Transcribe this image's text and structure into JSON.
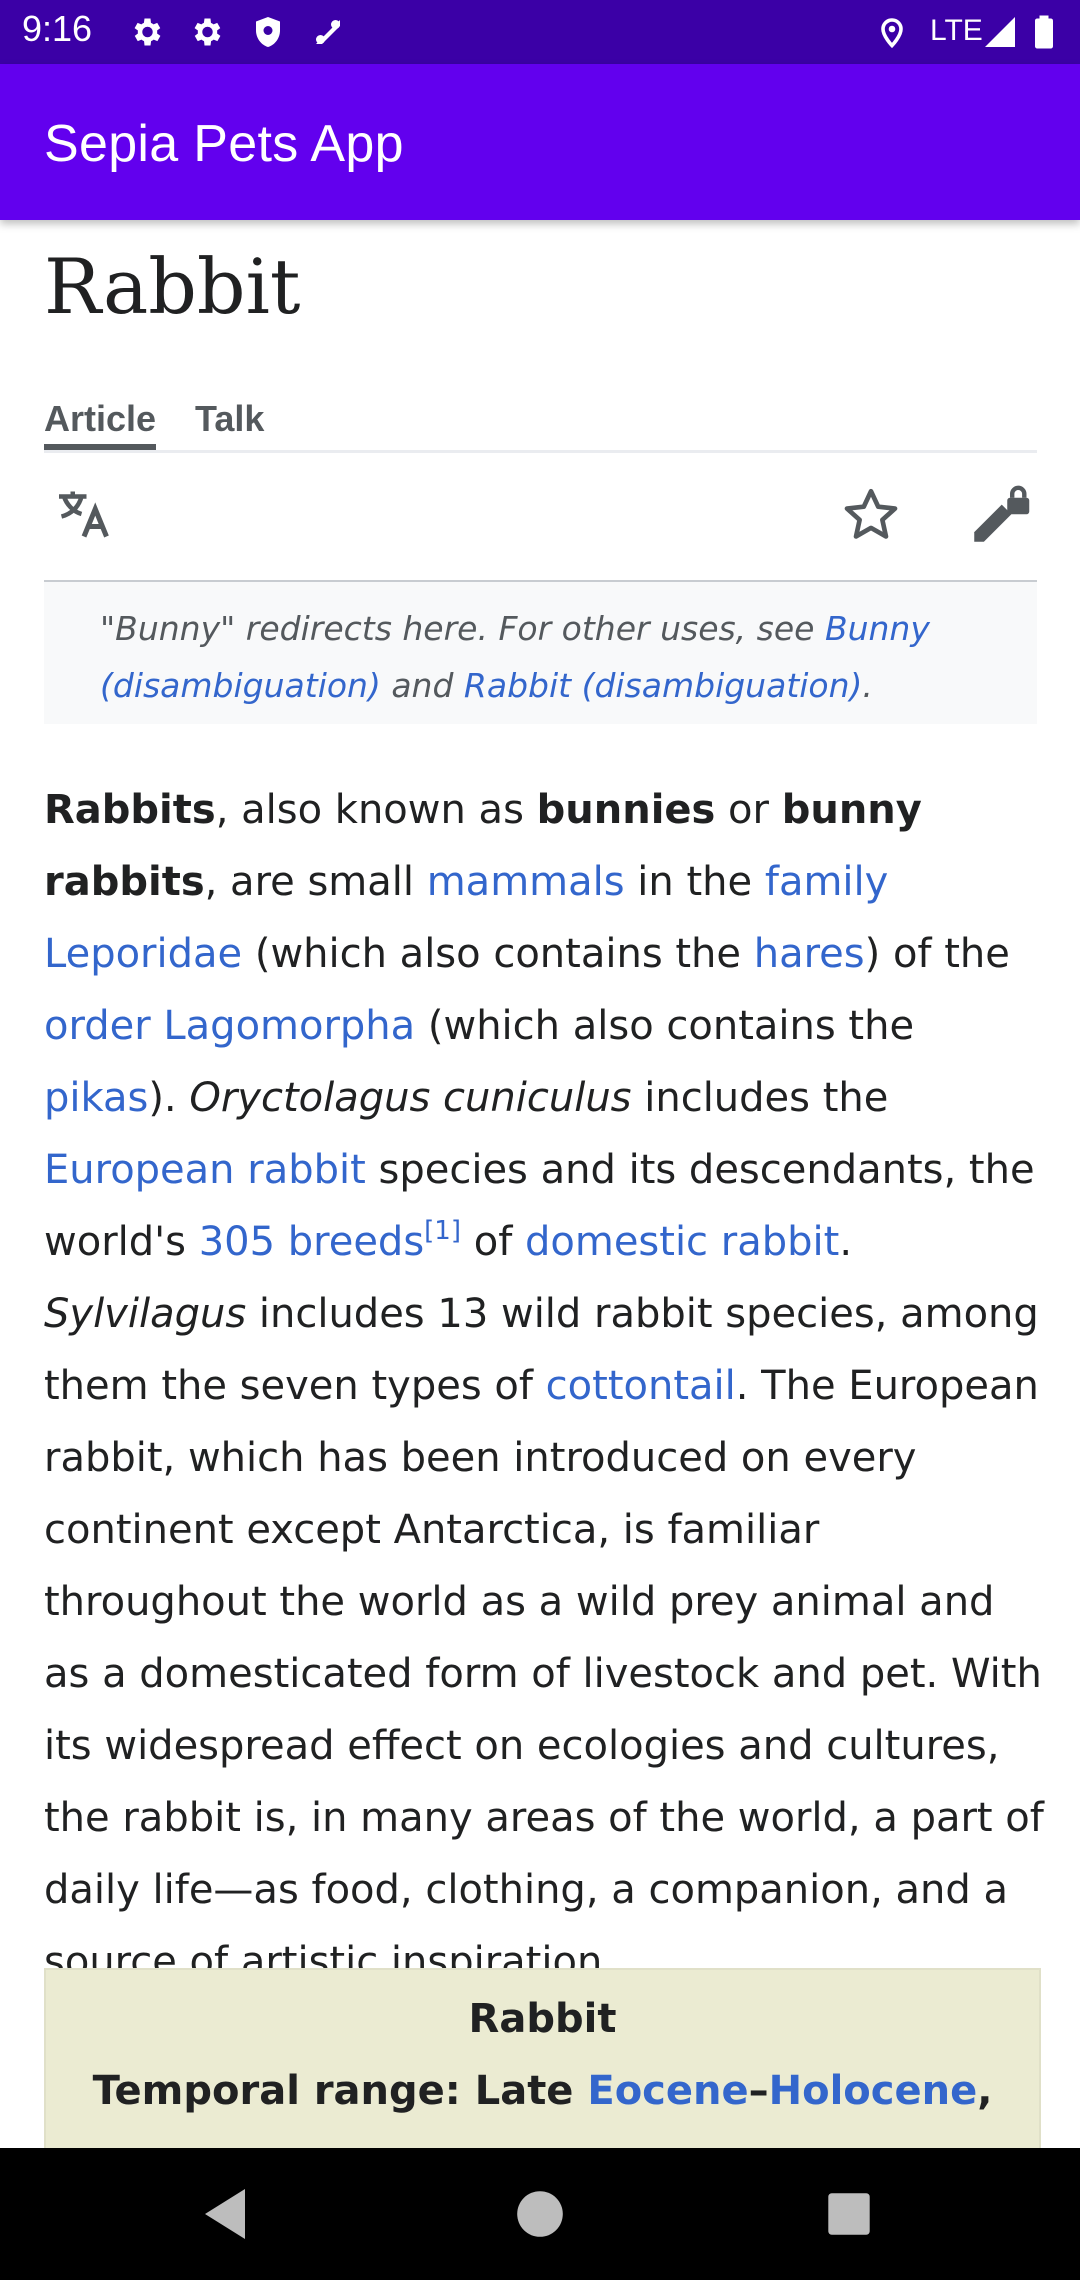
{
  "status_bar": {
    "time": "9:16",
    "network": "LTE",
    "icons": [
      "settings-icon",
      "settings-icon",
      "shield-icon",
      "signal-alt-icon",
      "location-icon",
      "cell-signal-icon",
      "battery-icon"
    ]
  },
  "app_bar": {
    "title": "Sepia Pets App"
  },
  "article": {
    "title": "Rabbit",
    "tabs": [
      {
        "label": "Article",
        "active": true
      },
      {
        "label": "Talk",
        "active": false
      }
    ],
    "hatnote": {
      "prefix": "\"Bunny\" redirects here. For other uses, see ",
      "link1": "Bunny (disambiguation)",
      "middle": " and ",
      "link2": "Rabbit (disambiguation)",
      "suffix": "."
    },
    "paragraph": {
      "t1_bold": "Rabbits",
      "t2": ", also known as ",
      "t3_bold": "bunnies",
      "t4": " or ",
      "t5_bold": "bunny rabbits",
      "t6": ", are small ",
      "l_mammals": "mammals",
      "t7": " in the ",
      "l_family": "family Leporidae",
      "t8": " (which also contains the ",
      "l_hares": "hares",
      "t9": ") of the ",
      "l_order": "order Lagomorpha",
      "t10": " (which also contains the ",
      "l_pikas": "pikas",
      "t11": "). ",
      "i_oryctolagus": "Oryctolagus cuniculus",
      "t12": " includes the ",
      "l_european": "European rabbit",
      "t13": " species and its descendants, the world's ",
      "l_breeds": "305 breeds",
      "ref": "[1]",
      "t14": " of ",
      "l_domestic": "domestic rabbit",
      "t15": ". ",
      "i_sylvilagus": "Sylvilagus",
      "t16": " includes 13 wild rabbit species, among them the seven types of ",
      "l_cottontail": "cottontail",
      "t17": ". The European rabbit, which has been introduced on every continent except Antarctica, is familiar throughout the world as a wild prey animal and as a domesticated form of livestock and pet. With its widespread effect on ecologies and cultures, the rabbit is, in many areas of the world, a part of daily life—as food, clothing, a companion, and a source of artistic inspiration."
    },
    "infobox": {
      "title": "Rabbit",
      "range_prefix": "Temporal range: Late ",
      "range_link1": "Eocene",
      "range_dash": "–",
      "range_link2": "Holocene",
      "range_suffix": ","
    }
  },
  "colors": {
    "status_bar": "#3b00a6",
    "app_bar": "#6200ee",
    "link": "#3366cc",
    "infobox_bg": "#ebebd2"
  }
}
